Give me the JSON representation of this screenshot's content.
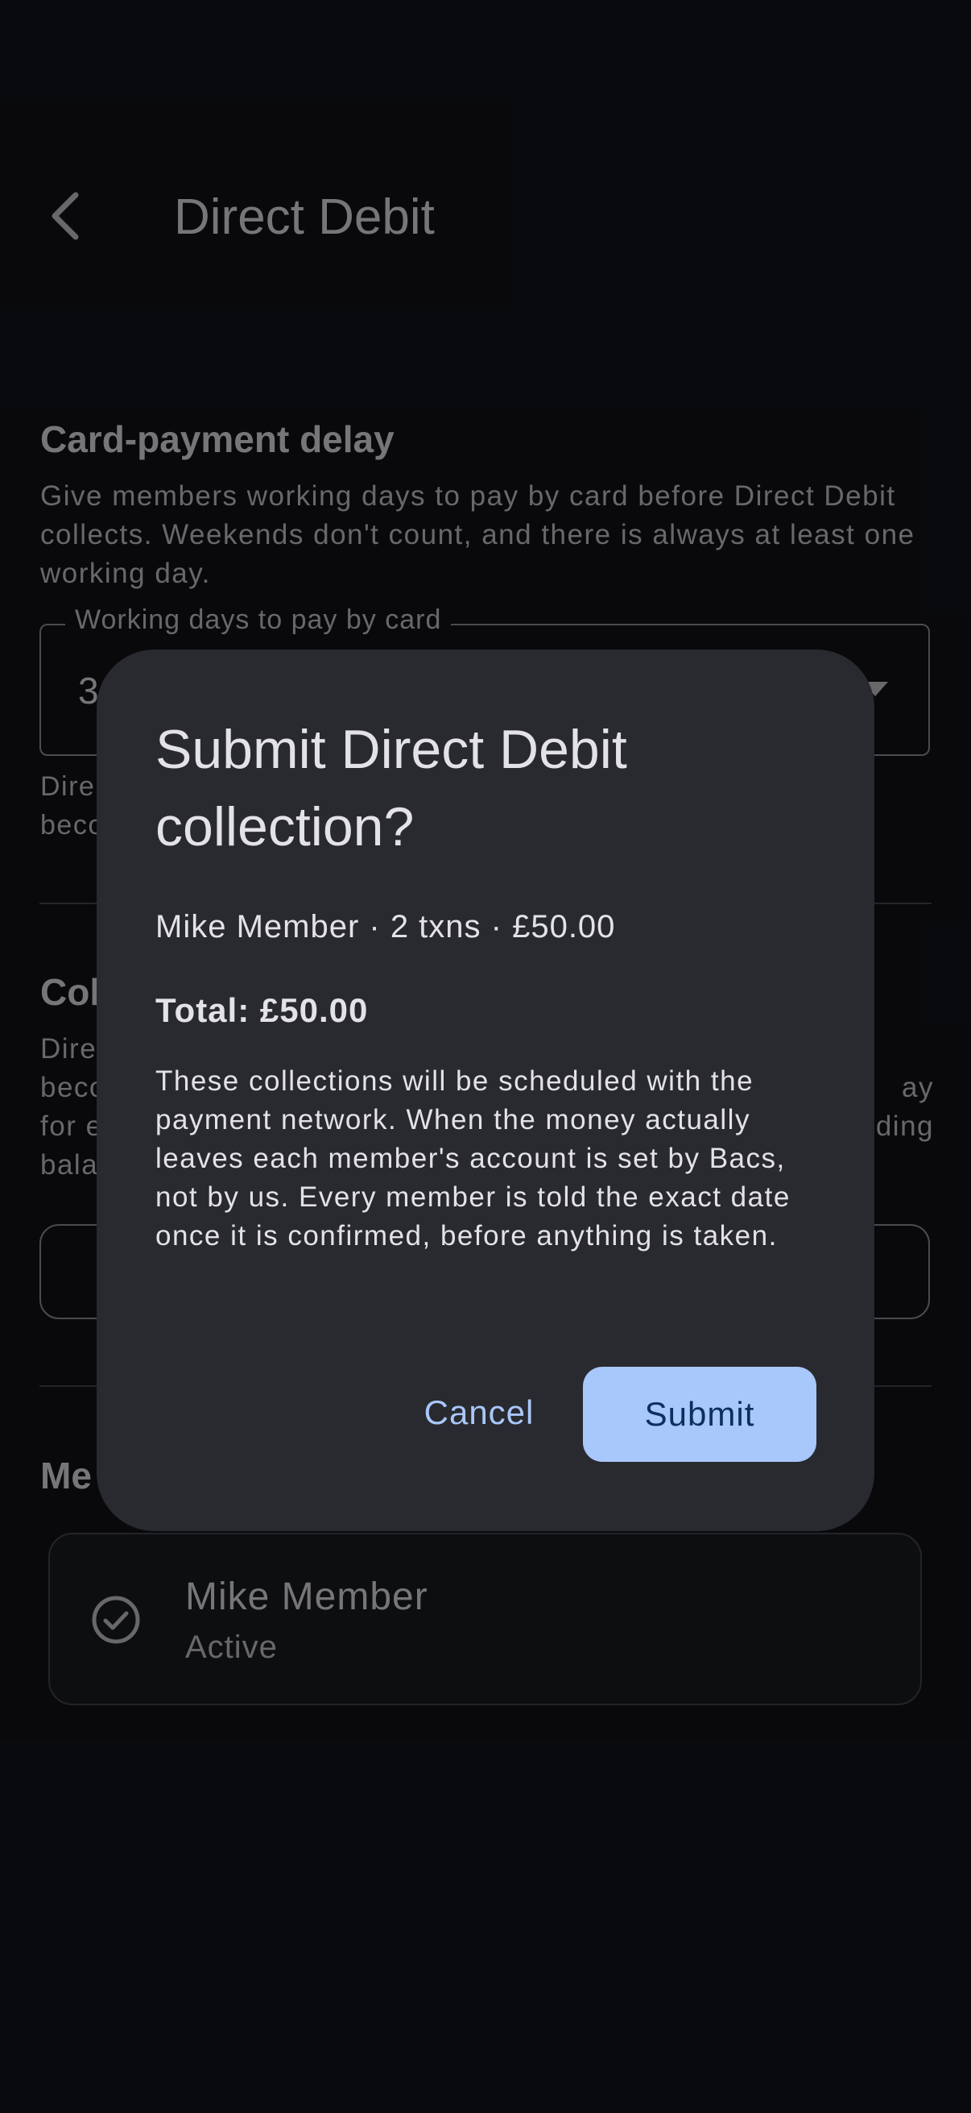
{
  "header": {
    "title": "Direct Debit"
  },
  "card_delay": {
    "heading": "Card-payment delay",
    "description": "Give members working days to pay by card before Direct Debit collects. Weekends don't count, and there is always at least one working day.",
    "field_label": "Working days to pay by card",
    "field_value": "3",
    "helper_prefix_line1": "Dire",
    "helper_prefix_line2": "beco"
  },
  "collections": {
    "heading_prefix": "Col",
    "desc_left": [
      "Dire",
      "beco",
      "for e",
      "bala"
    ],
    "desc_right": [
      "",
      "ay",
      "ding",
      ""
    ]
  },
  "members": {
    "heading_prefix": "Me",
    "items": [
      {
        "name": "Mike Member",
        "status": "Active"
      }
    ]
  },
  "dialog": {
    "title": "Submit Direct Debit collection?",
    "summary": "Mike Member · 2 txns · £50.00",
    "total": "Total: £50.00",
    "body": "These collections will be scheduled with the payment network. When the money actually leaves each member's account is set by Bacs, not by us. Every member is told the exact date once it is confirmed, before anything is taken.",
    "cancel_label": "Cancel",
    "submit_label": "Submit"
  },
  "colors": {
    "background": "#121318",
    "dialog_surface": "#292a2f",
    "primary": "#a8c7fa",
    "on_primary": "#0a305f"
  }
}
